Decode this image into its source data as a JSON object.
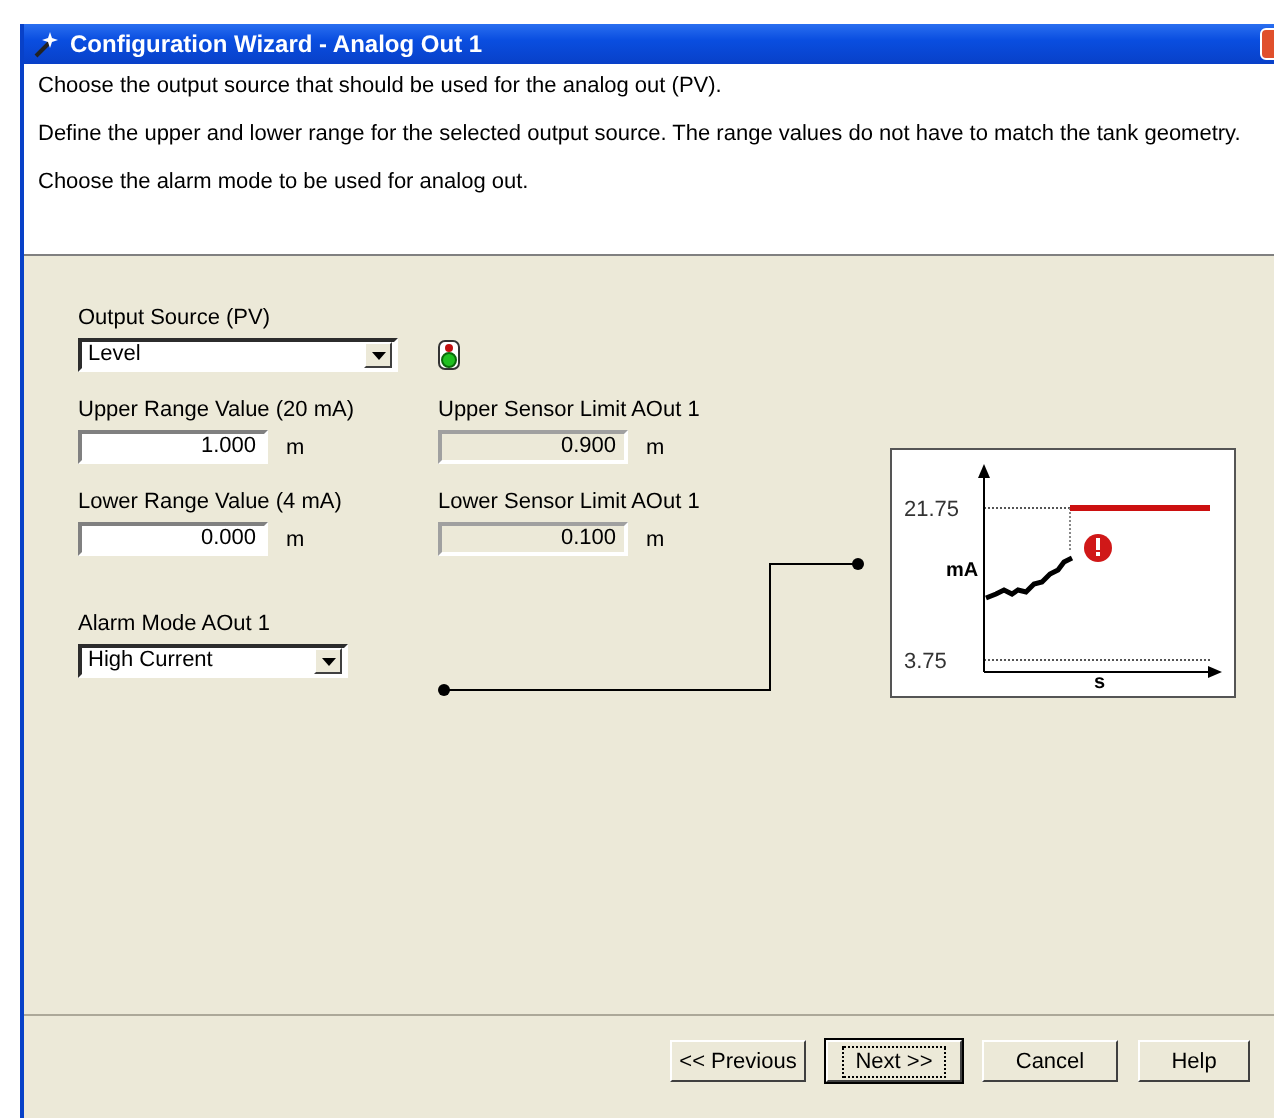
{
  "window": {
    "title": "Configuration Wizard - Analog Out 1"
  },
  "instructions": [
    "Choose the output source that should be used for the analog out (PV).",
    "Define the upper and lower range for the selected output source. The range values do not have to match the tank geometry.",
    "Choose the alarm mode to be used for analog out."
  ],
  "output_source": {
    "label": "Output Source (PV)",
    "value": "Level"
  },
  "status_indicator": {
    "on": true
  },
  "range_fields": [
    {
      "label": "Upper Range Value (20 mA)",
      "value": "1.000",
      "unit": "m",
      "disabled": false
    },
    {
      "label": "Upper Sensor Limit AOut 1",
      "value": "0.900",
      "unit": "m",
      "disabled": true
    },
    {
      "label": "Lower Range Value (4 mA)",
      "value": "0.000",
      "unit": "m",
      "disabled": false
    },
    {
      "label": "Lower Sensor Limit AOut 1",
      "value": "0.100",
      "unit": "m",
      "disabled": true
    }
  ],
  "alarm_mode": {
    "label": "Alarm Mode AOut 1",
    "value": "High Current"
  },
  "diagram": {
    "upper_label": "21.75",
    "lower_label": "3.75",
    "y_axis": "mA",
    "x_axis": "s"
  },
  "buttons": [
    {
      "label": "<< Previous",
      "default": false
    },
    {
      "label": "Next >>",
      "default": true
    },
    {
      "label": "Cancel",
      "default": false
    },
    {
      "label": "Help",
      "default": false
    }
  ]
}
